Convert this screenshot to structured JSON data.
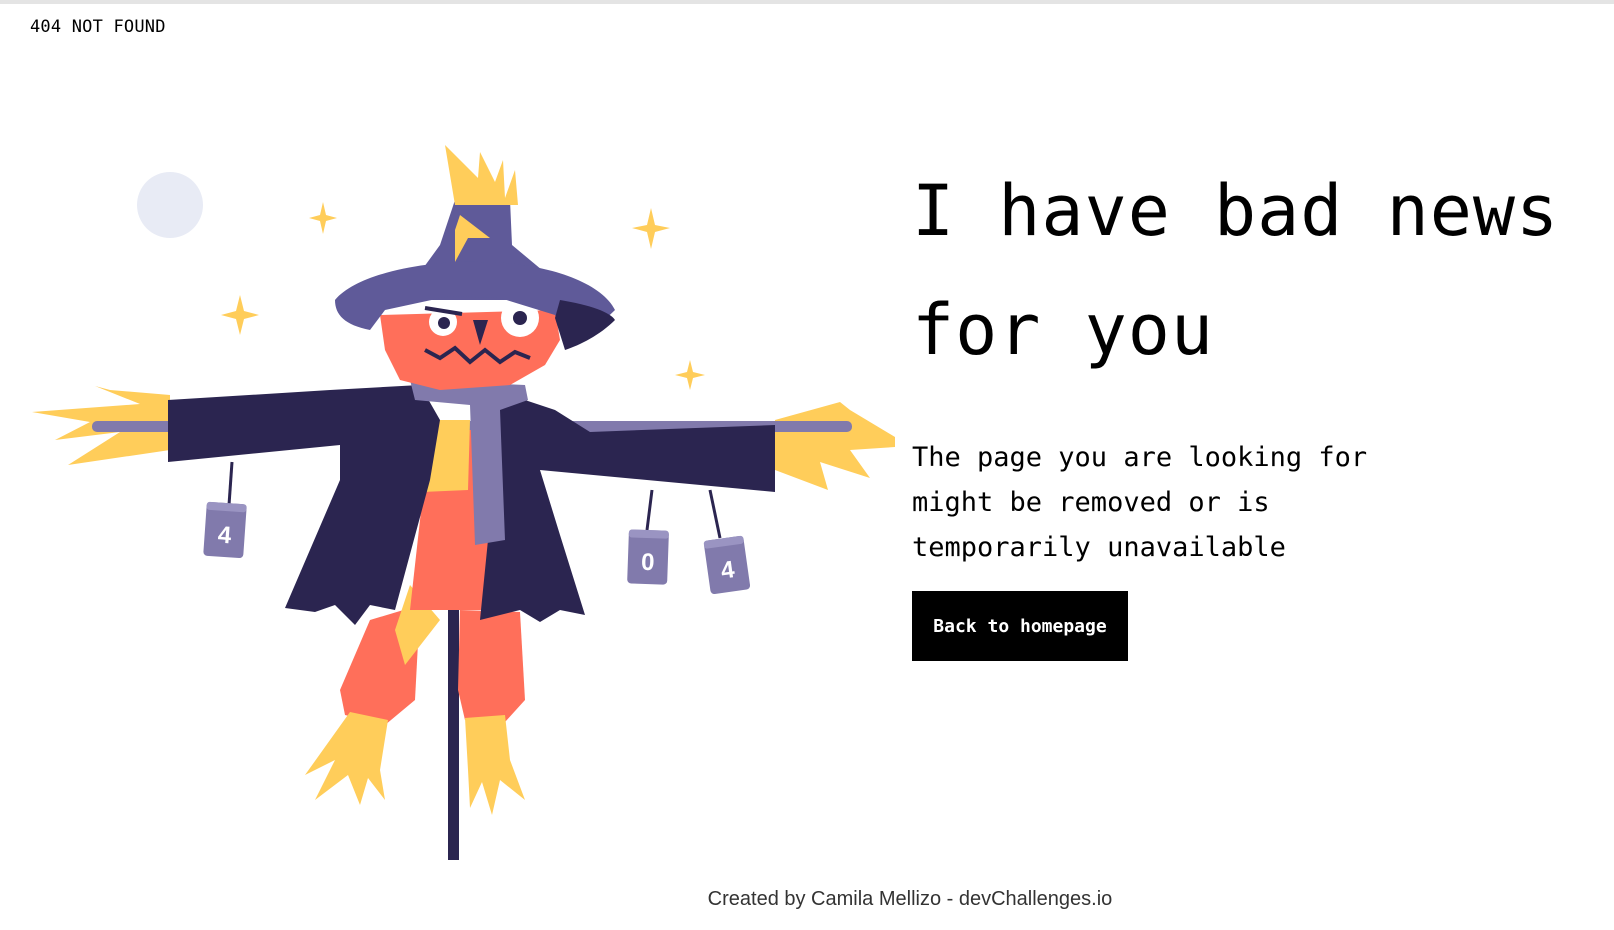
{
  "header": {
    "logo_text": "404 NOT FOUND"
  },
  "hero": {
    "headline": "I have bad news for you",
    "description": "The page you are looking for might be removed or is temporarily unavailable",
    "button_label": "Back to homepage"
  },
  "illustration": {
    "can_labels": [
      "4",
      "0",
      "4"
    ]
  },
  "footer": {
    "credit": "Created by Camila Mellizo - devChallenges.io"
  },
  "colors": {
    "background": "#ffffff",
    "text": "#000000",
    "button_bg": "#000000",
    "button_text": "#ffffff",
    "coat": "#2b2550",
    "hat": "#5f5a99",
    "pumpkin": "#ff6f5a",
    "straw": "#ffcd5a",
    "can": "#817aac",
    "moon": "#e8ebf5"
  }
}
